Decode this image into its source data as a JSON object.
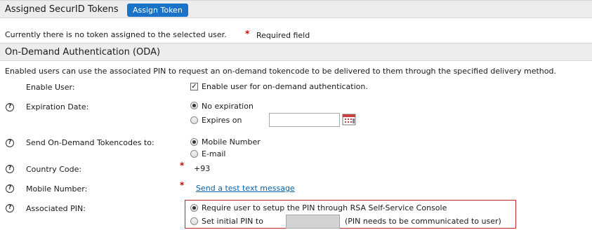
{
  "assigned_tokens": {
    "title": "Assigned SecurID Tokens",
    "assign_button": "Assign Token",
    "no_token_text": "Currently there is no token assigned to the selected user.",
    "required_field_text": "Required field"
  },
  "oda": {
    "title": "On-Demand Authentication (ODA)",
    "description": "Enabled users can use the associated PIN to request an on-demand tokencode to be delivered to them through the specified delivery method.",
    "enable_user": {
      "label": "Enable User:",
      "checkbox_label": "Enable user for on-demand authentication.",
      "checked": true
    },
    "expiration_date": {
      "label": "Expiration Date:",
      "options": [
        "No expiration",
        "Expires on"
      ],
      "selected": "No expiration",
      "date_value": ""
    },
    "send_tokencodes": {
      "label": "Send On-Demand Tokencodes to:",
      "options": [
        "Mobile Number",
        "E-mail"
      ],
      "selected": "Mobile Number"
    },
    "country_code": {
      "label": "Country Code:",
      "value": "+93"
    },
    "mobile_number": {
      "label": "Mobile Number:",
      "link_text": "Send a test text message"
    },
    "associated_pin": {
      "label": "Associated PIN:",
      "options": [
        "Require user to setup the PIN through RSA Self-Service Console",
        "Set initial PIN to"
      ],
      "selected": "Require user to setup the PIN through RSA Self-Service Console",
      "note": "(PIN needs to be communicated to user)",
      "highlight_color": "#c0282d"
    }
  },
  "colors": {
    "accent": "#1a73c7",
    "required": "#cc0000",
    "header_bg": "#ededed",
    "link": "#0b5fa5"
  }
}
